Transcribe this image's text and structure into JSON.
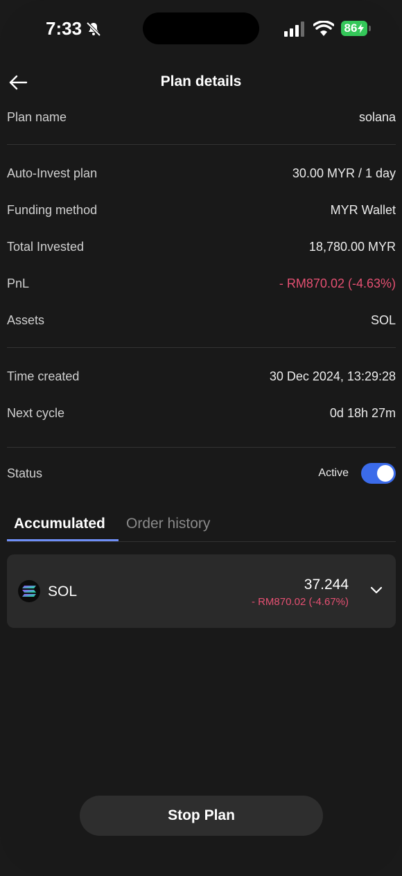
{
  "status_bar": {
    "time": "7:33",
    "battery": "86",
    "icons": [
      "bell-slash-icon",
      "cellular-signal-icon",
      "wifi-icon",
      "battery-charging-icon"
    ]
  },
  "header": {
    "title": "Plan details",
    "back_icon": "arrow-left-icon"
  },
  "plan": {
    "name_label": "Plan name",
    "name_value": "solana",
    "auto_invest_label": "Auto-Invest plan",
    "auto_invest_value": "30.00 MYR / 1 day",
    "funding_label": "Funding method",
    "funding_value": "MYR Wallet",
    "total_label": "Total Invested",
    "total_value": "18,780.00 MYR",
    "pnl_label": "PnL",
    "pnl_value": "- RM870.02 (-4.63%)",
    "assets_label": "Assets",
    "assets_value": "SOL",
    "time_created_label": "Time created",
    "time_created_value": "30 Dec 2024, 13:29:28",
    "next_cycle_label": "Next cycle",
    "next_cycle_value": "0d 18h 27m",
    "status_label": "Status",
    "status_value": "Active",
    "status_on": true
  },
  "tabs": {
    "accumulated": "Accumulated",
    "order_history": "Order history",
    "active": "Accumulated"
  },
  "asset_card": {
    "coin": "SOL",
    "amount": "37.244",
    "pnl": "- RM870.02 (-4.67%)"
  },
  "footer": {
    "stop_label": "Stop Plan"
  },
  "colors": {
    "background": "#191919",
    "negative": "#e55072",
    "accent": "#3b6bea",
    "battery": "#34c759"
  }
}
